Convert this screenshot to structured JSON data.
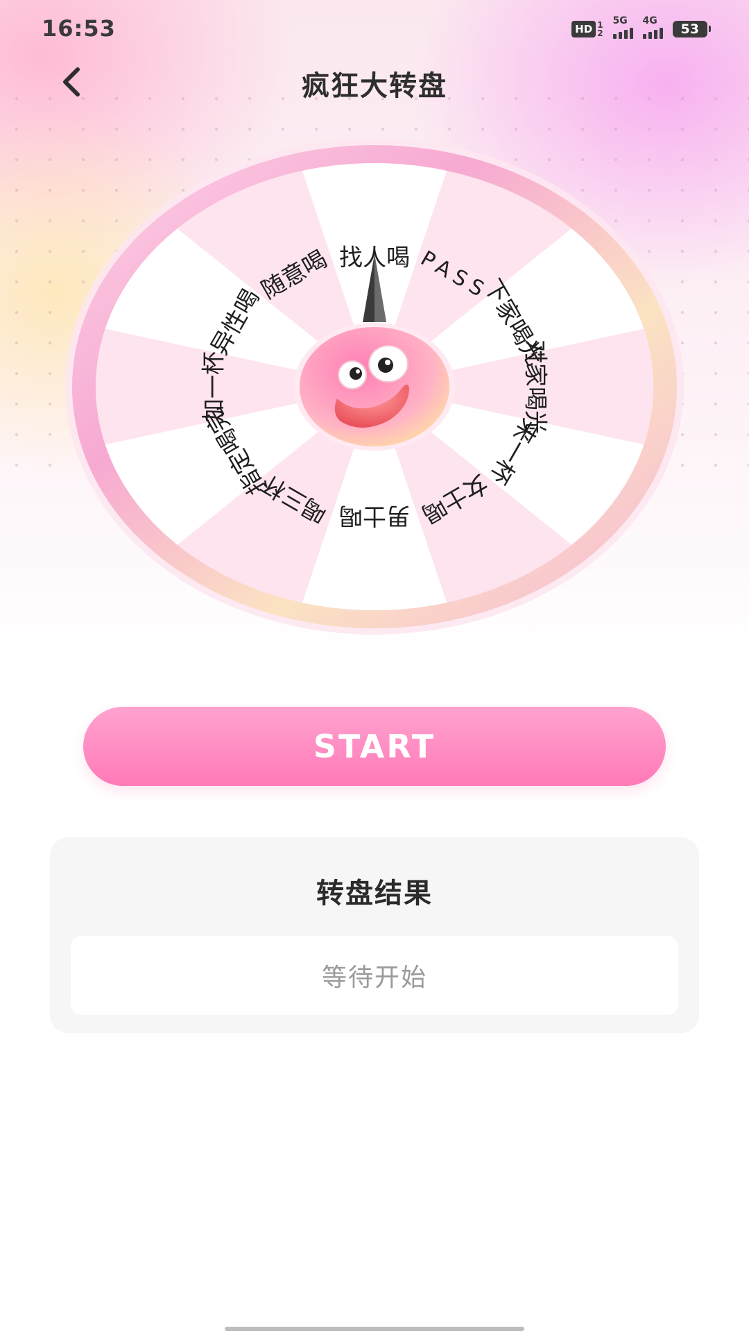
{
  "status_bar": {
    "time": "16:53",
    "hd_badge": "HD",
    "hd_sup": "1",
    "hd_sub": "2",
    "net1": "5G",
    "net2": "4G",
    "battery": "53"
  },
  "nav": {
    "title": "疯狂大转盘",
    "back_icon": "chevron-left-icon"
  },
  "wheel": {
    "segments": [
      "找人喝",
      "PASS",
      "下家喝光",
      "对家喝光",
      "来一杯",
      "女士喝",
      "男士喝",
      "喝三杯",
      "指定喝完",
      "加一杯",
      "异性喝",
      "随意喝"
    ],
    "center_icon": "smiley-face-icon",
    "pointer_icon": "pointer-needle-icon",
    "colors": {
      "segment_pink": "#fde4ef",
      "segment_white": "#ffffff",
      "rim": "#f8c3dd",
      "hub": "#ff8fbd"
    }
  },
  "start": {
    "label": "START"
  },
  "result": {
    "title": "转盘结果",
    "value": "等待开始"
  },
  "colors": {
    "accent": "#ff79b8",
    "title_text": "#2e2e2e"
  }
}
